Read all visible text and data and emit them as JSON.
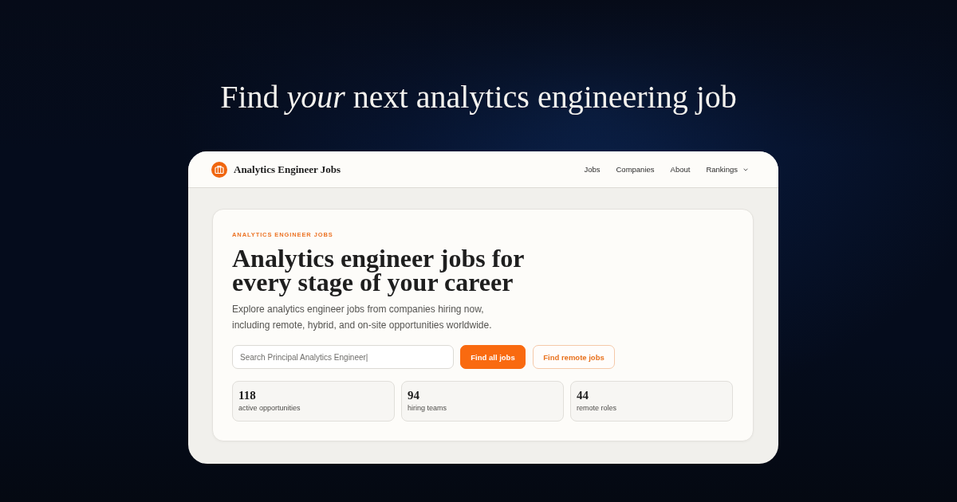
{
  "headline": "Find *your* next analytics engineering job",
  "browser": {
    "brand": "Analytics Engineer Jobs",
    "nav": [
      {
        "label": "Jobs",
        "kind": "link"
      },
      {
        "label": "Companies",
        "kind": "link"
      },
      {
        "label": "About",
        "kind": "link"
      },
      {
        "label": "Rankings",
        "kind": "dropdown"
      }
    ]
  },
  "hero": {
    "eyebrow": "ANALYTICS ENGINEER JOBS",
    "title": "Analytics engineer jobs for every stage of your career",
    "description": "Explore analytics engineer jobs from companies hiring now, including remote, hybrid, and on-site opportunities worldwide.",
    "search": {
      "placeholder": "Search Principal Analytics Engineer|"
    },
    "buttons": [
      {
        "label": "Find all jobs",
        "kind": "primary"
      },
      {
        "label": "Find remote jobs",
        "kind": "secondary"
      }
    ],
    "stats": [
      {
        "value": "118",
        "label": "active opportunities"
      },
      {
        "value": "94",
        "label": "hiring teams"
      },
      {
        "value": "44",
        "label": "remote roles"
      }
    ]
  }
}
